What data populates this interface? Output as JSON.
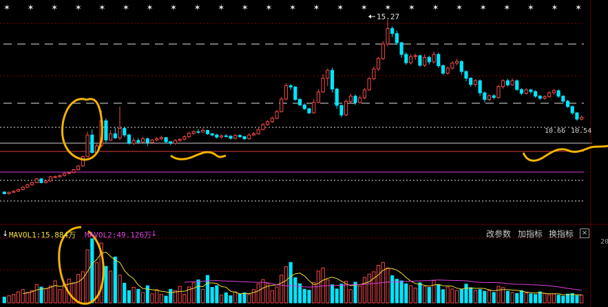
{
  "colors": {
    "up": "#ff4a4a",
    "down": "#00e5ff",
    "ma_yellow": "#f2e13a",
    "ma_magenta": "#e040e0",
    "annotation": "#f5b400",
    "grid": "#8a0000",
    "dashed_white": "#e6e6e6",
    "star": "#e6e6e6"
  },
  "price_panel": {
    "max_label": "15.27",
    "right_label": "10.66",
    "right_label_2": "10.54"
  },
  "volume_panel": {
    "indicator_arrow": "↓",
    "mavol1": "MAVOL1:15.884万",
    "mavol2": "MAVOL2:49.126万",
    "mavol2_arrow": "↓",
    "axis_label": "20",
    "toolbar": {
      "params": "改参数",
      "add_indicator": "加指标",
      "switch_indicator": "换指标",
      "close": "×"
    }
  },
  "chart_data": {
    "type": "candlestick",
    "stars_count": 25,
    "candles": [
      [
        7.03,
        6.95,
        7.06,
        6.92
      ],
      [
        6.95,
        7.02,
        7.05,
        6.9
      ],
      [
        7.02,
        7.07,
        7.1,
        6.98
      ],
      [
        7.07,
        7.15,
        7.2,
        7.04
      ],
      [
        7.15,
        7.26,
        7.3,
        7.12
      ],
      [
        7.26,
        7.38,
        7.42,
        7.22
      ],
      [
        7.38,
        7.48,
        7.52,
        7.33
      ],
      [
        7.48,
        7.66,
        7.7,
        7.45
      ],
      [
        7.66,
        7.48,
        7.7,
        7.44
      ],
      [
        7.48,
        7.56,
        7.62,
        7.44
      ],
      [
        7.56,
        7.76,
        7.8,
        7.52
      ],
      [
        7.76,
        7.76,
        7.82,
        7.7
      ],
      [
        7.76,
        7.82,
        7.86,
        7.72
      ],
      [
        7.82,
        7.92,
        7.96,
        7.78
      ],
      [
        7.92,
        7.96,
        8.0,
        7.88
      ],
      [
        7.96,
        8.1,
        8.14,
        7.92
      ],
      [
        8.1,
        8.28,
        8.32,
        8.06
      ],
      [
        8.28,
        8.72,
        8.78,
        8.24
      ],
      [
        8.72,
        9.76,
        9.92,
        8.7
      ],
      [
        9.76,
        8.92,
        10.02,
        8.88
      ],
      [
        8.92,
        9.24,
        9.34,
        8.86
      ],
      [
        9.24,
        10.44,
        10.92,
        9.18
      ],
      [
        10.44,
        9.52,
        10.56,
        9.4
      ],
      [
        9.52,
        9.82,
        9.98,
        9.48
      ],
      [
        9.82,
        9.62,
        10.12,
        9.58
      ],
      [
        9.62,
        10.08,
        11.12,
        9.52
      ],
      [
        10.08,
        9.76,
        10.16,
        9.66
      ],
      [
        9.76,
        9.36,
        9.82,
        9.3
      ],
      [
        9.36,
        9.5,
        9.64,
        9.28
      ],
      [
        9.5,
        9.42,
        9.62,
        9.32
      ],
      [
        9.42,
        9.58,
        9.68,
        9.38
      ],
      [
        9.58,
        9.4,
        9.64,
        9.22
      ],
      [
        9.4,
        9.52,
        9.58,
        9.34
      ],
      [
        9.52,
        9.58,
        9.66,
        9.46
      ],
      [
        9.58,
        9.64,
        9.72,
        9.52
      ],
      [
        9.64,
        9.44,
        9.66,
        9.38
      ],
      [
        9.44,
        9.36,
        9.48,
        9.28
      ],
      [
        9.36,
        9.5,
        9.56,
        9.3
      ],
      [
        9.5,
        9.56,
        9.6,
        9.44
      ],
      [
        9.56,
        9.68,
        9.74,
        9.5
      ],
      [
        9.68,
        9.84,
        9.92,
        9.62
      ],
      [
        9.84,
        9.92,
        9.98,
        9.78
      ],
      [
        9.92,
        9.9,
        10.04,
        9.82
      ],
      [
        9.9,
        9.98,
        10.1,
        9.86
      ],
      [
        9.98,
        9.82,
        10.02,
        9.76
      ],
      [
        9.82,
        9.76,
        9.86,
        9.7
      ],
      [
        9.76,
        9.66,
        9.82,
        9.58
      ],
      [
        9.66,
        9.72,
        9.78,
        9.6
      ],
      [
        9.72,
        9.7,
        9.8,
        9.64
      ],
      [
        9.7,
        9.6,
        9.76,
        9.54
      ],
      [
        9.6,
        9.74,
        9.8,
        9.56
      ],
      [
        9.74,
        9.68,
        9.8,
        9.62
      ],
      [
        9.68,
        9.58,
        9.72,
        9.52
      ],
      [
        9.58,
        9.76,
        9.84,
        9.54
      ],
      [
        9.76,
        9.82,
        9.9,
        9.72
      ],
      [
        9.82,
        10.02,
        10.1,
        9.78
      ],
      [
        10.02,
        10.26,
        10.34,
        9.98
      ],
      [
        10.26,
        10.4,
        10.48,
        10.2
      ],
      [
        10.4,
        10.56,
        10.64,
        10.34
      ],
      [
        10.56,
        10.88,
        10.96,
        10.52
      ],
      [
        10.88,
        11.48,
        11.58,
        10.84
      ],
      [
        11.48,
        12.12,
        12.24,
        11.42
      ],
      [
        12.12,
        12.06,
        12.2,
        11.92
      ],
      [
        12.06,
        11.46,
        12.1,
        11.4
      ],
      [
        11.46,
        11.2,
        11.52,
        11.14
      ],
      [
        11.2,
        11.02,
        11.28,
        10.96
      ],
      [
        11.02,
        10.82,
        11.06,
        10.76
      ],
      [
        10.82,
        11.32,
        11.48,
        10.78
      ],
      [
        11.32,
        11.82,
        11.96,
        11.28
      ],
      [
        11.82,
        12.48,
        12.68,
        11.78
      ],
      [
        12.48,
        12.86,
        12.94,
        12.1
      ],
      [
        12.86,
        11.96,
        12.98,
        11.8
      ],
      [
        11.96,
        11.18,
        12.02,
        11.02
      ],
      [
        11.18,
        10.72,
        11.2,
        10.6
      ],
      [
        10.72,
        11.36,
        11.46,
        10.66
      ],
      [
        11.36,
        11.62,
        11.74,
        11.28
      ],
      [
        11.62,
        11.32,
        11.7,
        11.2
      ],
      [
        11.32,
        11.54,
        11.66,
        11.26
      ],
      [
        11.54,
        11.92,
        12.02,
        11.48
      ],
      [
        11.92,
        12.46,
        12.54,
        11.88
      ],
      [
        12.46,
        12.92,
        13.04,
        12.38
      ],
      [
        12.92,
        13.42,
        13.5,
        12.84
      ],
      [
        13.42,
        14.12,
        14.26,
        13.36
      ],
      [
        14.12,
        14.86,
        15.27,
        14.02
      ],
      [
        14.86,
        14.62,
        14.96,
        14.46
      ],
      [
        14.62,
        14.18,
        14.76,
        14.06
      ],
      [
        14.18,
        13.62,
        14.22,
        13.46
      ],
      [
        13.62,
        13.22,
        13.72,
        13.12
      ],
      [
        13.22,
        13.52,
        13.62,
        13.14
      ],
      [
        13.52,
        13.56,
        13.66,
        13.36
      ],
      [
        13.56,
        13.1,
        13.6,
        13.02
      ],
      [
        13.1,
        13.48,
        13.62,
        13.02
      ],
      [
        13.48,
        13.26,
        13.56,
        13.14
      ],
      [
        13.26,
        13.62,
        13.76,
        13.18
      ],
      [
        13.62,
        13.08,
        13.7,
        12.98
      ],
      [
        13.08,
        12.72,
        13.14,
        12.64
      ],
      [
        12.72,
        12.96,
        13.04,
        12.66
      ],
      [
        12.96,
        13.2,
        13.3,
        12.88
      ],
      [
        13.2,
        13.28,
        13.42,
        13.1
      ],
      [
        13.28,
        12.8,
        13.34,
        12.64
      ],
      [
        12.8,
        12.48,
        12.86,
        12.34
      ],
      [
        12.48,
        12.18,
        12.52,
        12.06
      ],
      [
        12.18,
        12.36,
        12.44,
        12.08
      ],
      [
        12.36,
        11.78,
        12.42,
        11.62
      ],
      [
        11.78,
        11.46,
        11.84,
        11.32
      ],
      [
        11.46,
        11.64,
        11.72,
        11.38
      ],
      [
        11.64,
        11.56,
        11.72,
        11.46
      ],
      [
        11.56,
        12.08,
        12.16,
        11.5
      ],
      [
        12.08,
        12.36,
        12.44,
        11.98
      ],
      [
        12.36,
        12.16,
        12.46,
        12.08
      ],
      [
        12.16,
        12.36,
        12.48,
        12.12
      ],
      [
        12.36,
        11.94,
        12.42,
        11.88
      ],
      [
        11.94,
        11.76,
        12.0,
        11.66
      ],
      [
        11.76,
        11.92,
        12.0,
        11.7
      ],
      [
        11.92,
        11.84,
        11.98,
        11.74
      ],
      [
        11.84,
        11.62,
        11.9,
        11.54
      ],
      [
        11.62,
        11.52,
        11.68,
        11.44
      ],
      [
        11.52,
        11.6,
        11.66,
        11.46
      ],
      [
        11.6,
        11.78,
        11.86,
        11.54
      ],
      [
        11.78,
        11.88,
        11.96,
        11.7
      ],
      [
        11.88,
        11.62,
        11.94,
        11.54
      ],
      [
        11.62,
        11.38,
        11.66,
        11.26
      ],
      [
        11.38,
        11.12,
        11.44,
        11.06
      ],
      [
        11.12,
        10.82,
        11.18,
        10.72
      ],
      [
        10.82,
        10.52,
        10.86,
        10.44
      ],
      [
        10.52,
        10.61,
        10.7,
        10.46
      ]
    ],
    "volume": [
      1.8,
      2.2,
      2.6,
      3.4,
      4.1,
      3.2,
      3.8,
      5.6,
      4.9,
      4.4,
      5.2,
      6.8,
      4.1,
      5.9,
      7.3,
      6.2,
      8.8,
      9.6,
      16.4,
      19.8,
      12.4,
      18.5,
      11.3,
      9.8,
      14.2,
      8.6,
      6.1,
      3.8,
      4.8,
      4.2,
      3.2,
      5.3,
      2.8,
      4.1,
      2.6,
      2.1,
      4.2,
      3.8,
      5.1,
      2.6,
      4.9,
      6.2,
      7.1,
      4.2,
      8.5,
      4.8,
      5.3,
      2.4,
      3.1,
      2.2,
      3.4,
      2.8,
      3.1,
      2.6,
      4.1,
      5.9,
      7.2,
      6.1,
      3.8,
      4.9,
      8.6,
      11.2,
      12.5,
      7.8,
      5.9,
      4.2,
      3.9,
      6.3,
      9.8,
      10.8,
      7.1,
      5.6,
      4.3,
      5.8,
      6.7,
      4.1,
      6.4,
      5.2,
      7.9,
      8.9,
      9.6,
      11.6,
      12.5,
      10.8,
      8.4,
      7.3,
      6.8,
      5.9,
      5.3,
      4.6,
      6.2,
      5.1,
      4.8,
      6.9,
      5.6,
      4.1,
      4.9,
      4.3,
      3.8,
      4.2,
      5.8,
      4.7,
      3.9,
      4.1,
      3.6,
      3.8,
      3.2,
      5.1,
      4.7,
      3.6,
      3.2,
      2.9,
      3.8,
      3.1,
      2.8,
      2.6,
      3.4,
      2.9,
      2.5,
      2.8,
      2.4,
      2.1,
      2.7,
      2.9,
      2.2,
      2.4
    ]
  }
}
